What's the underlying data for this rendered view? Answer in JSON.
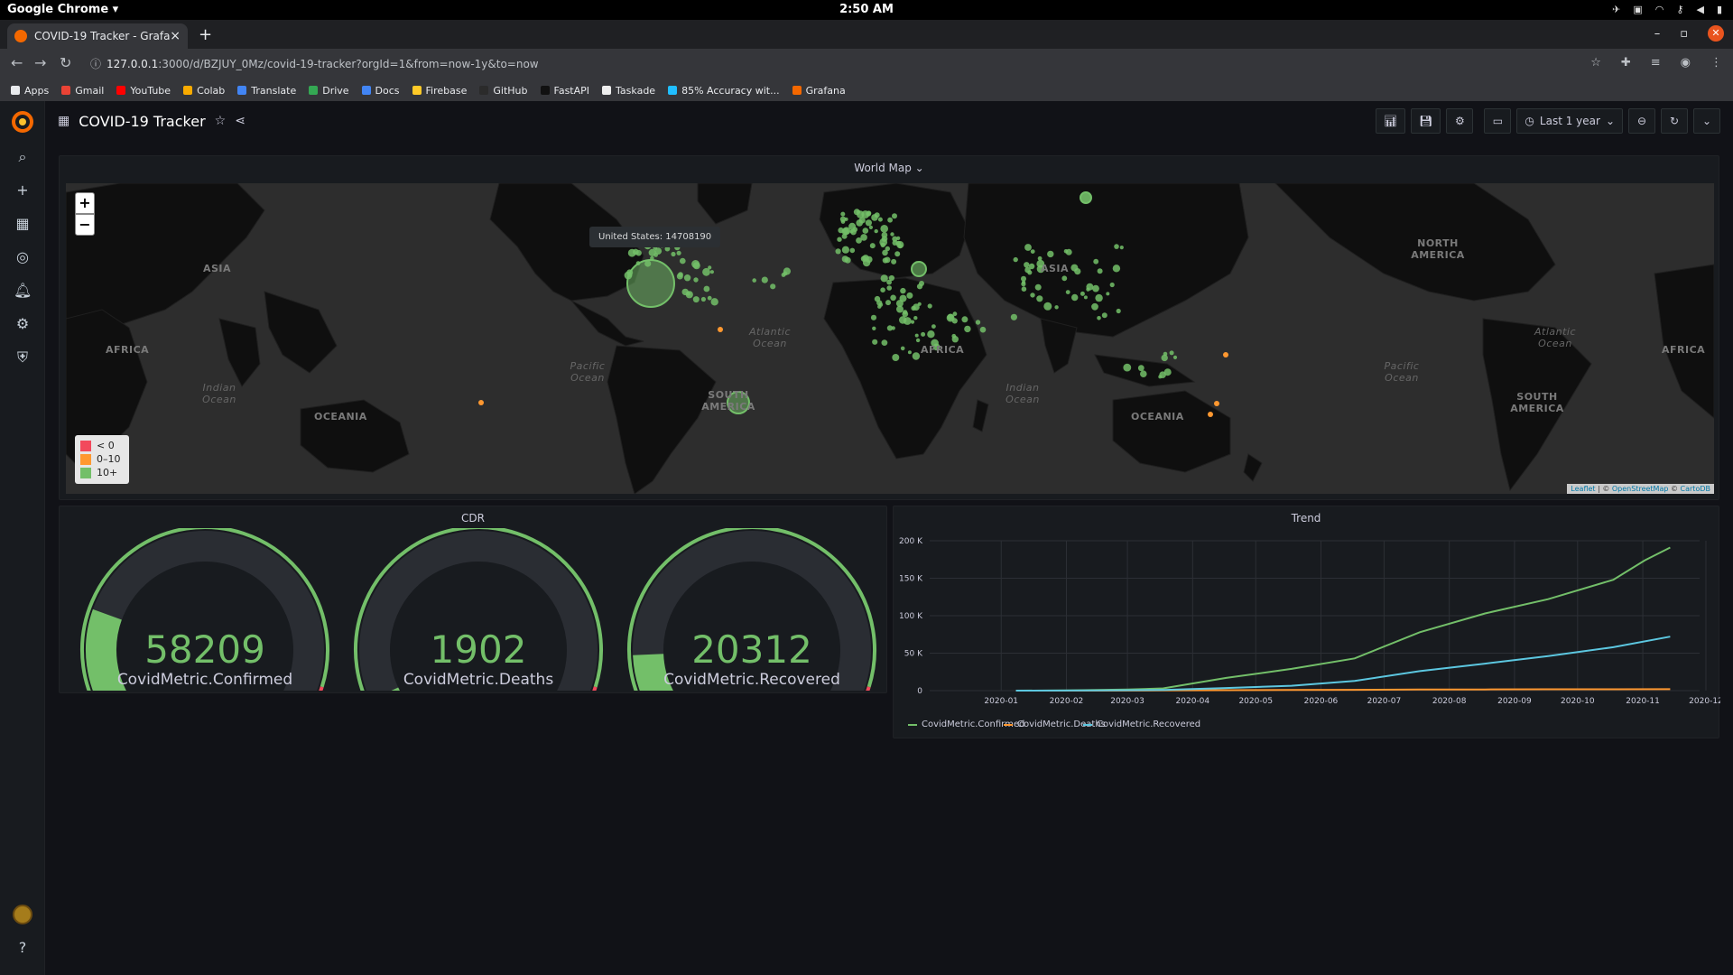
{
  "os": {
    "app_name": "Google Chrome",
    "clock": "2:50 AM"
  },
  "browser": {
    "tab_title": "COVID-19 Tracker - Grafana",
    "url_host": "127.0.0.1",
    "url_rest": ":3000/d/BZJUY_0Mz/covid-19-tracker?orgId=1&from=now-1y&to=now",
    "bookmarks": [
      {
        "label": "Apps",
        "color": "#e8eaed"
      },
      {
        "label": "Gmail",
        "color": "#ea4335"
      },
      {
        "label": "YouTube",
        "color": "#ff0000"
      },
      {
        "label": "Colab",
        "color": "#f9ab00"
      },
      {
        "label": "Translate",
        "color": "#4285f4"
      },
      {
        "label": "Drive",
        "color": "#34a853"
      },
      {
        "label": "Docs",
        "color": "#4285f4"
      },
      {
        "label": "Firebase",
        "color": "#ffca28"
      },
      {
        "label": "GitHub",
        "color": "#2b2b2b"
      },
      {
        "label": "FastAPI",
        "color": "#111111"
      },
      {
        "label": "Taskade",
        "color": "#eeeeee"
      },
      {
        "label": "85% Accuracy wit...",
        "color": "#20beff"
      },
      {
        "label": "Grafana",
        "color": "#f46800"
      }
    ]
  },
  "dashboard": {
    "title": "COVID-19 Tracker",
    "time_range": "Last 1 year",
    "accent": "#73bf69"
  },
  "worldmap": {
    "title": "World Map",
    "tooltip": "United States: 14708190",
    "zoom_in": "+",
    "zoom_out": "−",
    "legend": [
      {
        "label": "< 0",
        "color": "#f2495c"
      },
      {
        "label": "0–10",
        "color": "#ff9830"
      },
      {
        "label": "10+",
        "color": "#73bf69"
      }
    ],
    "attribution_leaflet": "Leaflet",
    "attribution_sep": " | © ",
    "attribution_osm": "OpenStreetMap",
    "attribution_mid": " © ",
    "attribution_carto": "CartoDB",
    "labels": {
      "asia": "ASIA",
      "north_america": "NORTH AMERICA",
      "africa": "AFRICA",
      "south_america": "SOUTH AMERICA",
      "oceania": "OCEANIA",
      "atlantic": "Atlantic Ocean",
      "pacific": "Pacific Ocean",
      "indian": "Indian Ocean"
    }
  },
  "cdr": {
    "title": "CDR",
    "gauges": [
      {
        "label": "CovidMetric.Confirmed",
        "value": "58209",
        "fraction": 0.22
      },
      {
        "label": "CovidMetric.Deaths",
        "value": "1902",
        "fraction": 0.04
      },
      {
        "label": "CovidMetric.Recovered",
        "value": "20312",
        "fraction": 0.13
      }
    ]
  },
  "trend": {
    "title": "Trend",
    "legend": [
      {
        "label": "CovidMetric.Confirmed",
        "color": "#73bf69"
      },
      {
        "label": "CovidMetric.Deaths",
        "color": "#f2cc0c"
      },
      {
        "label": "CovidMetric.Recovered",
        "color": "#73bf69"
      }
    ]
  },
  "chart_data": {
    "type": "line",
    "title": "Trend",
    "x": [
      "2020-01",
      "2020-02",
      "2020-03",
      "2020-04",
      "2020-05",
      "2020-06",
      "2020-07",
      "2020-08",
      "2020-09",
      "2020-10",
      "2020-11",
      "2020-12"
    ],
    "y_ticks": [
      "0",
      "50 K",
      "100 K",
      "150 K",
      "200 K"
    ],
    "ylim": [
      0,
      200000
    ],
    "grid": true,
    "legend_position": "bottom-left",
    "series": [
      {
        "name": "CovidMetric.Confirmed",
        "color": "#73bf69",
        "points": [
          [
            "2020-01-22",
            0
          ],
          [
            "2020-02-15",
            200
          ],
          [
            "2020-03-15",
            1500
          ],
          [
            "2020-04-01",
            3000
          ],
          [
            "2020-05-01",
            17000
          ],
          [
            "2020-06-01",
            29000
          ],
          [
            "2020-07-01",
            43000
          ],
          [
            "2020-08-01",
            78000
          ],
          [
            "2020-09-01",
            103000
          ],
          [
            "2020-10-01",
            122000
          ],
          [
            "2020-11-01",
            148000
          ],
          [
            "2020-11-16",
            174000
          ],
          [
            "2020-11-28",
            191000
          ]
        ]
      },
      {
        "name": "CovidMetric.Deaths",
        "color": "#ff9830",
        "points": [
          [
            "2020-01-22",
            0
          ],
          [
            "2020-03-01",
            50
          ],
          [
            "2020-04-01",
            300
          ],
          [
            "2020-05-01",
            600
          ],
          [
            "2020-06-01",
            900
          ],
          [
            "2020-07-01",
            1100
          ],
          [
            "2020-08-01",
            1400
          ],
          [
            "2020-09-01",
            1600
          ],
          [
            "2020-10-01",
            1750
          ],
          [
            "2020-11-01",
            1850
          ],
          [
            "2020-11-28",
            1902
          ]
        ]
      },
      {
        "name": "CovidMetric.Recovered",
        "color": "#5cc7e0",
        "points": [
          [
            "2020-01-22",
            0
          ],
          [
            "2020-03-01",
            200
          ],
          [
            "2020-04-01",
            1000
          ],
          [
            "2020-05-01",
            3500
          ],
          [
            "2020-06-01",
            6500
          ],
          [
            "2020-07-01",
            13000
          ],
          [
            "2020-08-01",
            26000
          ],
          [
            "2020-09-01",
            36000
          ],
          [
            "2020-10-01",
            46000
          ],
          [
            "2020-11-01",
            58000
          ],
          [
            "2020-11-28",
            72000
          ]
        ]
      }
    ]
  }
}
